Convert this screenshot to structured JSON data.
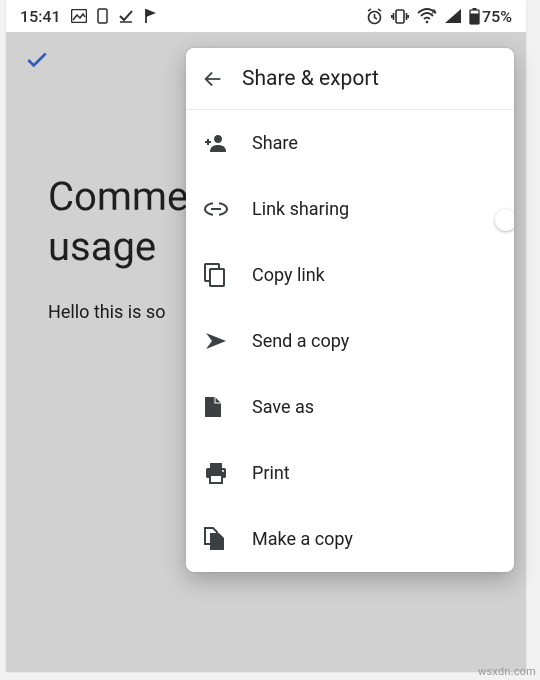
{
  "statusbar": {
    "time": "15:41",
    "battery": "75%"
  },
  "underlay": {
    "title_line1": "Comme",
    "title_line2": "usage",
    "body": "Hello this is so"
  },
  "panel": {
    "title": "Share & export",
    "items": {
      "share": "Share",
      "link_sharing": "Link sharing",
      "copy_link": "Copy link",
      "send_copy": "Send a copy",
      "save_as": "Save as",
      "print": "Print",
      "make_copy": "Make a copy"
    },
    "link_sharing_on": false
  },
  "watermark": "wsxdn.com"
}
